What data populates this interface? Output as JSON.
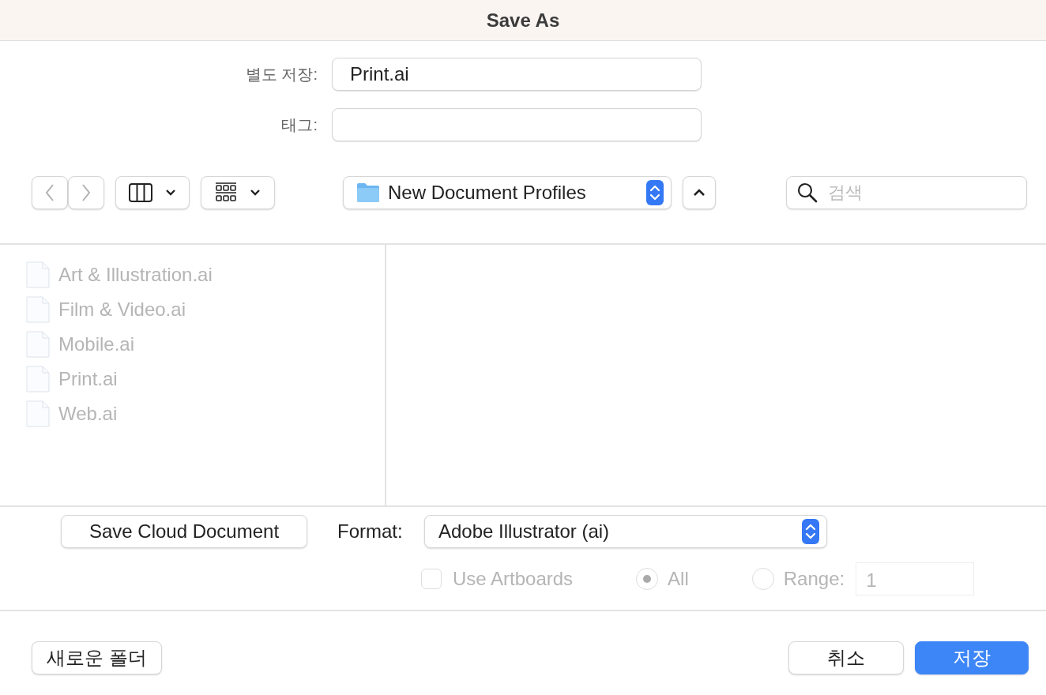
{
  "window": {
    "title": "Save As"
  },
  "fields": [
    {
      "label": "별도 저장:",
      "value": "Print.ai"
    },
    {
      "label": "태그:"
    }
  ],
  "toolbar": {
    "back_disabled": true,
    "forward_disabled": true,
    "location": "New Document Profiles",
    "search": {
      "placeholder": "검색"
    }
  },
  "files": [
    {
      "name": "Art & Illustration.ai",
      "disabled": true
    },
    {
      "name": "Film & Video.ai",
      "disabled": true
    },
    {
      "name": "Mobile.ai",
      "disabled": true
    },
    {
      "name": "Print.ai",
      "disabled": true
    },
    {
      "name": "Web.ai",
      "disabled": true
    }
  ],
  "options": {
    "cloud_button": "Save Cloud Document",
    "format_label": "Format:",
    "format": "Adobe Illustrator (ai)",
    "use_artboards": {
      "label": "Use Artboards",
      "checked": false,
      "disabled": true
    },
    "radios": [
      {
        "label": "All",
        "selected": true,
        "disabled": true
      },
      {
        "label": "Range:",
        "selected": false,
        "disabled": true
      }
    ],
    "range_value": "1"
  },
  "buttons": {
    "new_folder": "새로운 폴더",
    "cancel": "취소",
    "save": "저장"
  }
}
